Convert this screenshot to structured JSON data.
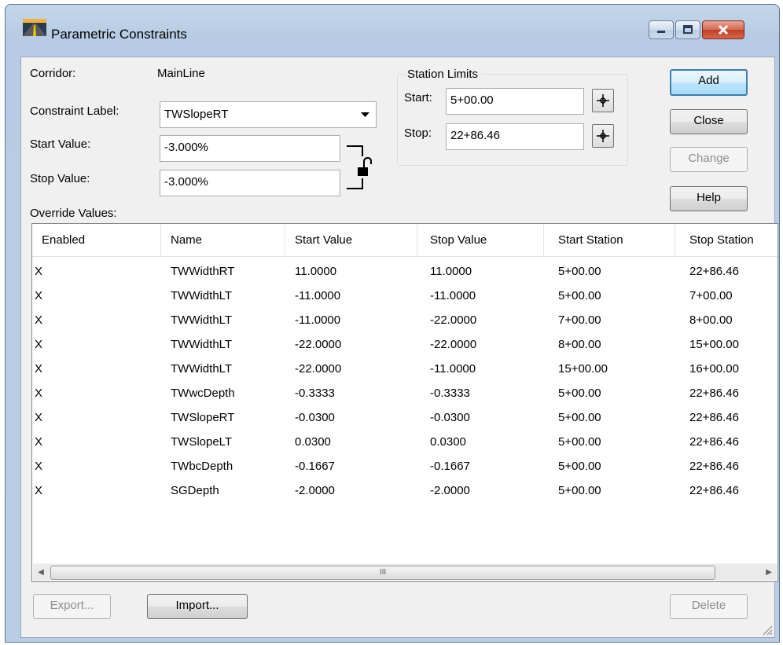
{
  "window": {
    "title": "Parametric Constraints",
    "controls": {
      "minimize": "minimize-icon",
      "maximize": "maximize-icon",
      "close": "close-icon"
    }
  },
  "form": {
    "corridor_label": "Corridor:",
    "corridor_value": "MainLine",
    "constraint_label_label": "Constraint Label:",
    "constraint_label_value": "TWSlopeRT",
    "start_value_label": "Start Value:",
    "start_value": "-3.000%",
    "stop_value_label": "Stop Value:",
    "stop_value": "-3.000%",
    "override_values_label": "Override Values:"
  },
  "station_limits": {
    "title": "Station Limits",
    "start_label": "Start:",
    "start_value": "5+00.00",
    "stop_label": "Stop:",
    "stop_value": "22+86.46"
  },
  "buttons": {
    "add": "Add",
    "close": "Close",
    "change": "Change",
    "help": "Help",
    "export": "Export...",
    "import": "Import...",
    "delete": "Delete"
  },
  "table": {
    "columns": [
      "Enabled",
      "Name",
      "Start Value",
      "Stop Value",
      "Start Station",
      "Stop Station"
    ],
    "rows": [
      [
        "X",
        "TWWidthRT",
        "11.0000",
        "11.0000",
        "5+00.00",
        "22+86.46"
      ],
      [
        "X",
        "TWWidthLT",
        "-11.0000",
        "-11.0000",
        "5+00.00",
        "7+00.00"
      ],
      [
        "X",
        "TWWidthLT",
        "-11.0000",
        "-22.0000",
        "7+00.00",
        "8+00.00"
      ],
      [
        "X",
        "TWWidthLT",
        "-22.0000",
        "-22.0000",
        "8+00.00",
        "15+00.00"
      ],
      [
        "X",
        "TWWidthLT",
        "-22.0000",
        "-11.0000",
        "15+00.00",
        "16+00.00"
      ],
      [
        "X",
        "TWwcDepth",
        "-0.3333",
        "-0.3333",
        "5+00.00",
        "22+86.46"
      ],
      [
        "X",
        "TWSlopeRT",
        "-0.0300",
        "-0.0300",
        "5+00.00",
        "22+86.46"
      ],
      [
        "X",
        "TWSlopeLT",
        "0.0300",
        "0.0300",
        "5+00.00",
        "22+86.46"
      ],
      [
        "X",
        "TWbcDepth",
        "-0.1667",
        "-0.1667",
        "5+00.00",
        "22+86.46"
      ],
      [
        "X",
        "SGDepth",
        "-2.0000",
        "-2.0000",
        "5+00.00",
        "22+86.46"
      ]
    ],
    "scroll_thumb_grip": "III"
  }
}
